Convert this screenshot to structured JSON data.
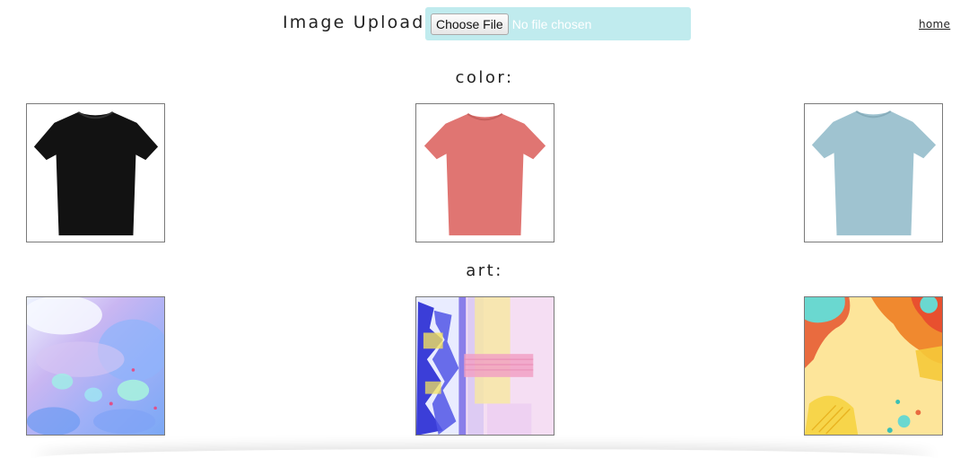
{
  "upload": {
    "label": "Image Upload:",
    "button_label": "Choose File",
    "status_text": "No file chosen"
  },
  "nav": {
    "home_label": "home"
  },
  "sections": {
    "color_title": "color:",
    "art_title": "art:"
  },
  "colors": {
    "upload_box_bg": "#c0ebee",
    "shirt_black": "#121212",
    "shirt_coral": "#e07572",
    "shirt_blue": "#9fc3d0"
  },
  "color_options": [
    {
      "name": "black t-shirt",
      "color": "#121212"
    },
    {
      "name": "coral t-shirt",
      "color": "#e07572"
    },
    {
      "name": "light blue t-shirt",
      "color": "#9fc3d0"
    }
  ],
  "art_options": [
    {
      "name": "blue watercolor art"
    },
    {
      "name": "pink and blue abstract art"
    },
    {
      "name": "yellow and orange abstract art"
    }
  ]
}
